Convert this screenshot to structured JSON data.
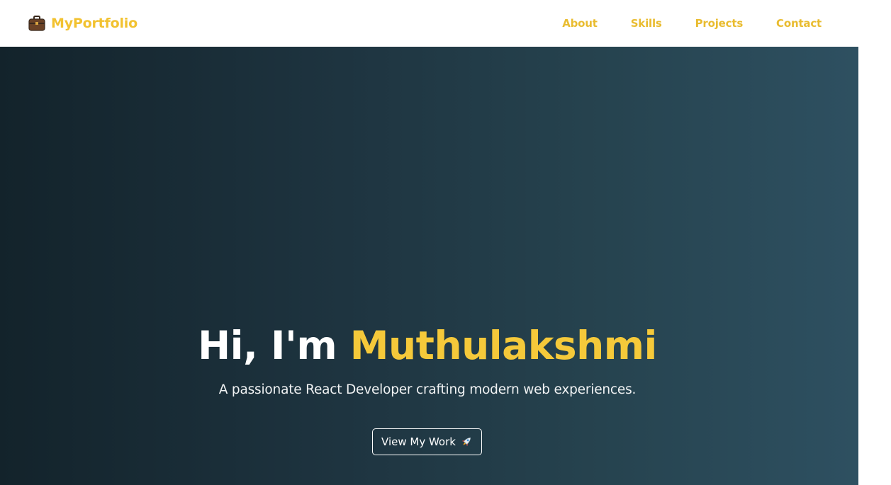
{
  "navbar": {
    "brand": {
      "icon": "briefcase-icon",
      "label": "MyPortfolio"
    },
    "links": [
      {
        "label": "About"
      },
      {
        "label": "Skills"
      },
      {
        "label": "Projects"
      },
      {
        "label": "Contact"
      }
    ]
  },
  "hero": {
    "greeting": "Hi, I'm ",
    "name": "Muthulakshmi",
    "subtitle": "A passionate React Developer crafting modern web experiences.",
    "cta_label": "View My Work",
    "cta_icon": "rocket-icon"
  },
  "colors": {
    "accent": "#f2c230",
    "hero_gradient_start": "#13232b",
    "hero_gradient_end": "#2e5061",
    "nav_background": "#ffffff"
  }
}
